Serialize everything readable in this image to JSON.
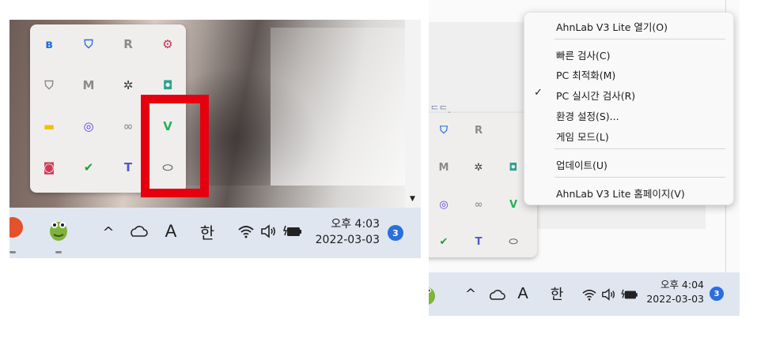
{
  "left_taskbar": {
    "chevron": "^",
    "language": "A",
    "ime": "한",
    "time": "오후 4:03",
    "date": "2022-03-03",
    "notifications": "3"
  },
  "right_taskbar": {
    "chevron": "^",
    "language": "A",
    "ime": "한",
    "time": "오후 4:04",
    "date": "2022-03-03",
    "notifications": "3"
  },
  "tray_icons_left": [
    {
      "name": "bluetooth-icon",
      "glyph": "ʙ",
      "color": "#1e6fe0"
    },
    {
      "name": "windows-security-warning-icon",
      "glyph": "⛉",
      "color": "#2a6fdb"
    },
    {
      "name": "r-app-icon",
      "glyph": "R",
      "color": "#8a8a8a"
    },
    {
      "name": "red-gear-app-icon",
      "glyph": "⚙",
      "color": "#c0305a"
    },
    {
      "name": "shield-gray-icon",
      "glyph": "⛉",
      "color": "#8a8a8a"
    },
    {
      "name": "mcafee-warning-icon",
      "glyph": "M",
      "color": "#8a8a8a"
    },
    {
      "name": "slack-icon",
      "glyph": "✲",
      "color": "#3b3b3b"
    },
    {
      "name": "teal-app-icon",
      "glyph": "◘",
      "color": "#2ba38e"
    },
    {
      "name": "kakaotalk-icon",
      "glyph": "▬",
      "color": "#f2c200"
    },
    {
      "name": "purple-chat-icon",
      "glyph": "◎",
      "color": "#5b3ee0"
    },
    {
      "name": "creative-cloud-icon",
      "glyph": "∞",
      "color": "#9a9a9a"
    },
    {
      "name": "ahnlab-v3-icon",
      "glyph": "V",
      "color": "#22b35a"
    },
    {
      "name": "headset-icon",
      "glyph": "◙",
      "color": "#d23a5a"
    },
    {
      "name": "green-shield-icon",
      "glyph": "✔",
      "color": "#1f9e3c"
    },
    {
      "name": "teams-icon",
      "glyph": "T",
      "color": "#5059c9"
    },
    {
      "name": "pill-icon",
      "glyph": "⬭",
      "color": "#6a6a6a"
    }
  ],
  "tray_icons_right": [
    {
      "name": "windows-security-warning-icon",
      "glyph": "⛉",
      "color": "#2a6fdb"
    },
    {
      "name": "r-app-icon",
      "glyph": "R",
      "color": "#8a8a8a"
    },
    {
      "name": "mcafee-warning-icon",
      "glyph": "M",
      "color": "#8a8a8a"
    },
    {
      "name": "slack-icon",
      "glyph": "✲",
      "color": "#3b3b3b"
    },
    {
      "name": "teal-app-icon",
      "glyph": "◘",
      "color": "#2ba38e"
    },
    {
      "name": "purple-chat-icon",
      "glyph": "◎",
      "color": "#5b3ee0"
    },
    {
      "name": "creative-cloud-icon",
      "glyph": "∞",
      "color": "#9a9a9a"
    },
    {
      "name": "ahnlab-v3-icon",
      "glyph": "V",
      "color": "#22b35a"
    },
    {
      "name": "green-shield-icon",
      "glyph": "✔",
      "color": "#1f9e3c"
    },
    {
      "name": "teams-icon",
      "glyph": "T",
      "color": "#5059c9"
    },
    {
      "name": "pill-icon",
      "glyph": "⬭",
      "color": "#6a6a6a"
    }
  ],
  "context_menu": {
    "open": "AhnLab V3 Lite 열기(O)",
    "quick_scan": "빠른 검사(C)",
    "pc_optimize": "PC 최적화(M)",
    "realtime_scan": "PC 실시간 검사(R)",
    "realtime_scan_checked": "✓",
    "settings": "환경 설정(S)...",
    "game_mode": "게임 모드(L)",
    "update": "업데이트(U)",
    "homepage": "AhnLab V3 Lite 홈페이지(V)"
  },
  "colors": {
    "highlight_box": "#e6000f",
    "taskbar": "#dfe6f0",
    "badge": "#2a6fdb"
  }
}
